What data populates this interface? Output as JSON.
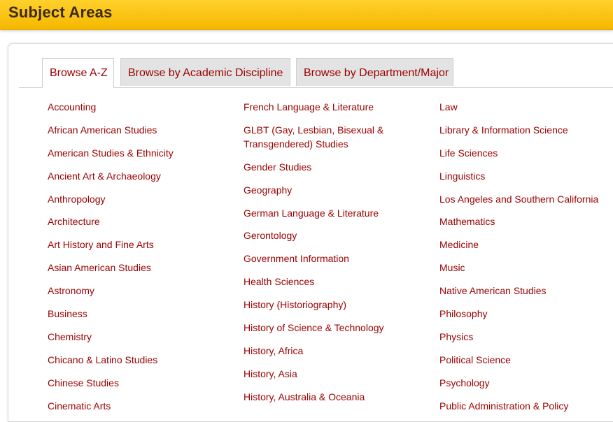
{
  "header": {
    "title": "Subject Areas"
  },
  "tabs": [
    {
      "label": "Browse A-Z",
      "active": true
    },
    {
      "label": "Browse by Academic Discipline",
      "active": false
    },
    {
      "label": "Browse by Department/Major",
      "active": false
    }
  ],
  "columns": [
    [
      "Accounting",
      "African American Studies",
      "American Studies & Ethnicity",
      "Ancient Art & Archaeology",
      "Anthropology",
      "Architecture",
      "Art History and Fine Arts",
      "Asian American Studies",
      "Astronomy",
      "Business",
      "Chemistry",
      "Chicano & Latino Studies",
      "Chinese Studies",
      "Cinematic Arts"
    ],
    [
      "French Language & Literature",
      "GLBT (Gay, Lesbian, Bisexual & Transgendered) Studies",
      "Gender Studies",
      "Geography",
      "German Language & Literature",
      "Gerontology",
      "Government Information",
      "Health Sciences",
      "History (Historiography)",
      "History of Science & Technology",
      "History, Africa",
      "History, Asia",
      "History, Australia & Oceania"
    ],
    [
      "Law",
      "Library & Information Science",
      "Life Sciences",
      "Linguistics",
      "Los Angeles and Southern California",
      "Mathematics",
      "Medicine",
      "Music",
      "Native American Studies",
      "Philosophy",
      "Physics",
      "Political Science",
      "Psychology",
      "Public Administration & Policy"
    ]
  ],
  "colors": {
    "link": "#990000",
    "header_bg": "#ffc20e",
    "header_text": "#3a2a10"
  }
}
